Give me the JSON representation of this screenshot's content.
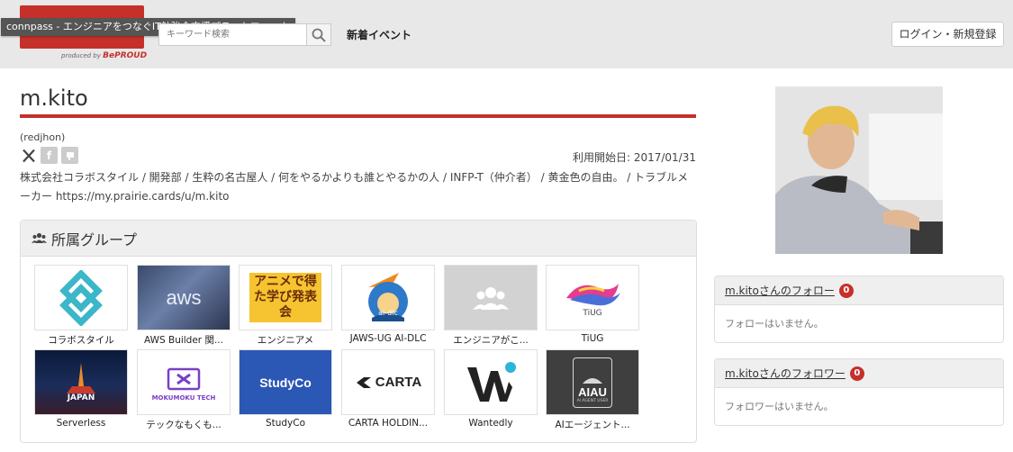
{
  "header": {
    "tooltip": "connpass - エンジニアをつなぐIT勉強会支援プラットフォーム",
    "logo_produced_by": "produced by",
    "logo_brand": "BePROUD",
    "search_placeholder": "キーワード検索",
    "nav_new_events": "新着イベント",
    "login_label": "ログイン・新規登録",
    "accent_color": "#c6302a"
  },
  "profile": {
    "name": "m.kito",
    "user_id": "(redjhon)",
    "social_icons": [
      "x-icon",
      "facebook-icon",
      "github-icon"
    ],
    "start_date": "利用開始日: 2017/01/31",
    "bio": "株式会社コラボスタイル / 開発部 / 生粋の名古屋人 / 何をやるかよりも誰とやるかの人 / INFP-T（仲介者） / 黄金色の自由。 / トラブルメーカー https://my.prairie.cards/u/m.kito"
  },
  "groups": {
    "title": "所属グループ",
    "items": [
      {
        "name": "コラボスタイル",
        "logo_text": ""
      },
      {
        "name": "AWS Builder 関...",
        "logo_text": "aws"
      },
      {
        "name": "エンジニアメ",
        "logo_text": "アニメで得た学び発表会"
      },
      {
        "name": "JAWS-UG AI-DLC",
        "logo_text": "ai-dlc"
      },
      {
        "name": "エンジニアがこ...",
        "logo_text": ""
      },
      {
        "name": "TiUG",
        "logo_text": "TiUG"
      },
      {
        "name": "Serverless",
        "logo_text": "JAPAN"
      },
      {
        "name": "テックなもくも...",
        "logo_text": "MOKUMOKU TECH"
      },
      {
        "name": "StudyCo",
        "logo_text": "StudyCo"
      },
      {
        "name": "CARTA HOLDIN...",
        "logo_text": "CARTA"
      },
      {
        "name": "Wantedly",
        "logo_text": ""
      },
      {
        "name": "AIエージェント...",
        "logo_text": "AIAU",
        "logo_sub": "AI AGENT USER"
      }
    ]
  },
  "following": {
    "title": "m.kitoさんのフォロー",
    "count": "0",
    "empty": "フォローはいません。"
  },
  "followers": {
    "title": "m.kitoさんのフォロワー",
    "count": "0",
    "empty": "フォロワーはいません。"
  }
}
